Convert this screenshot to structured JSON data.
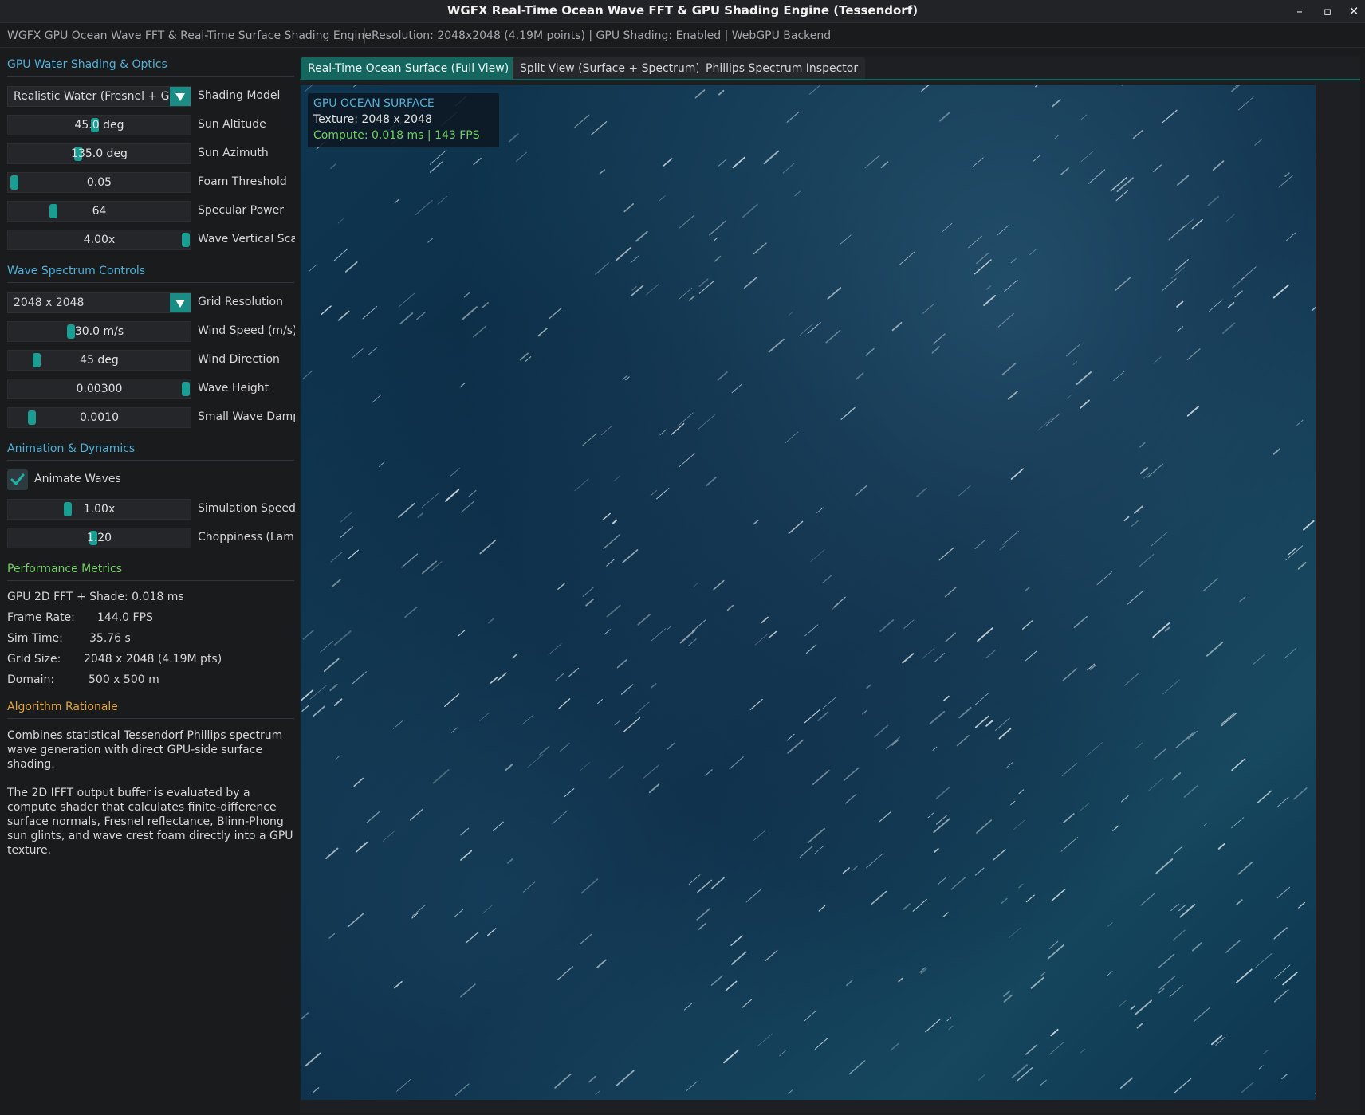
{
  "window": {
    "title": "WGFX Real-Time Ocean Wave FFT & GPU Shading Engine (Tessendorf)",
    "minimize_glyph": "–",
    "maximize_glyph": "▫",
    "close_glyph": "✕"
  },
  "infobar": {
    "app_name": "WGFX GPU Ocean Wave FFT & Real-Time Surface Shading Engine",
    "status": "Resolution: 2048x2048 (4.19M points) | GPU Shading: Enabled | WebGPU Backend"
  },
  "shading": {
    "header": "GPU Water Shading & Optics",
    "shading_model": {
      "value": "Realistic Water (Fresnel + Glint)",
      "label": "Shading Model"
    },
    "sun_altitude": {
      "value": "45.0 deg",
      "label": "Sun Altitude",
      "fraction": 0.47
    },
    "sun_azimuth": {
      "value": "135.0 deg",
      "label": "Sun Azimuth",
      "fraction": 0.37
    },
    "foam_threshold": {
      "value": "0.05",
      "label": "Foam Threshold",
      "fraction": 0.0
    },
    "specular_power": {
      "value": "64",
      "label": "Specular Power",
      "fraction": 0.23
    },
    "wave_vertical_scale": {
      "value": "4.00x",
      "label": "Wave Vertical Scale",
      "fraction": 1.0
    }
  },
  "spectrum": {
    "header": "Wave Spectrum Controls",
    "grid_resolution": {
      "value": "2048 x 2048",
      "label": "Grid Resolution"
    },
    "wind_speed": {
      "value": "30.0 m/s",
      "label": "Wind Speed (m/s)",
      "fraction": 0.33
    },
    "wind_direction": {
      "value": "45 deg",
      "label": "Wind Direction",
      "fraction": 0.13
    },
    "wave_height": {
      "value": "0.00300",
      "label": "Wave Height",
      "fraction": 1.0
    },
    "small_wave_damping": {
      "value": "0.0010",
      "label": "Small Wave Damping",
      "fraction": 0.1
    }
  },
  "animation": {
    "header": "Animation & Dynamics",
    "animate_waves": {
      "label": "Animate Waves",
      "checked": true
    },
    "simulation_speed": {
      "value": "1.00x",
      "label": "Simulation Speed",
      "fraction": 0.31
    },
    "choppiness": {
      "value": "1.20",
      "label": "Choppiness (Lambda)",
      "fraction": 0.46
    }
  },
  "performance": {
    "header": "Performance Metrics",
    "fft_shade": "GPU 2D FFT + Shade: 0.018 ms",
    "frame_rate_label": "Frame Rate:",
    "frame_rate_value": "144.0 FPS",
    "sim_time_label": "Sim Time:",
    "sim_time_value": "35.76 s",
    "grid_size_label": "Grid Size:",
    "grid_size_value": "2048 x 2048 (4.19M pts)",
    "domain_label": "Domain:",
    "domain_value": "500 x 500 m"
  },
  "rationale": {
    "header": "Algorithm Rationale",
    "para1": "Combines statistical Tessendorf Phillips spectrum wave generation with direct GPU-side surface shading.",
    "para2": "The 2D IFFT output buffer is evaluated by a compute shader that calculates finite-difference surface normals, Fresnel reflectance, Blinn-Phong sun glints, and wave crest foam directly into a GPU texture."
  },
  "tabs": {
    "full_view": "Real-Time Ocean Surface (Full View)",
    "split_view": "Split View (Surface + Spectrum)",
    "inspector": "Phillips Spectrum Inspector"
  },
  "overlay": {
    "title": "GPU OCEAN SURFACE",
    "texture": "Texture: 2048 x 2048",
    "compute": "Compute: 0.018 ms | 143 FPS"
  },
  "colors": {
    "accent": "#1a9e93",
    "header_blue": "#4fb0d8",
    "header_green": "#6fce62",
    "header_orange": "#e3a43a",
    "ocean_deep": "#0c2c45"
  }
}
